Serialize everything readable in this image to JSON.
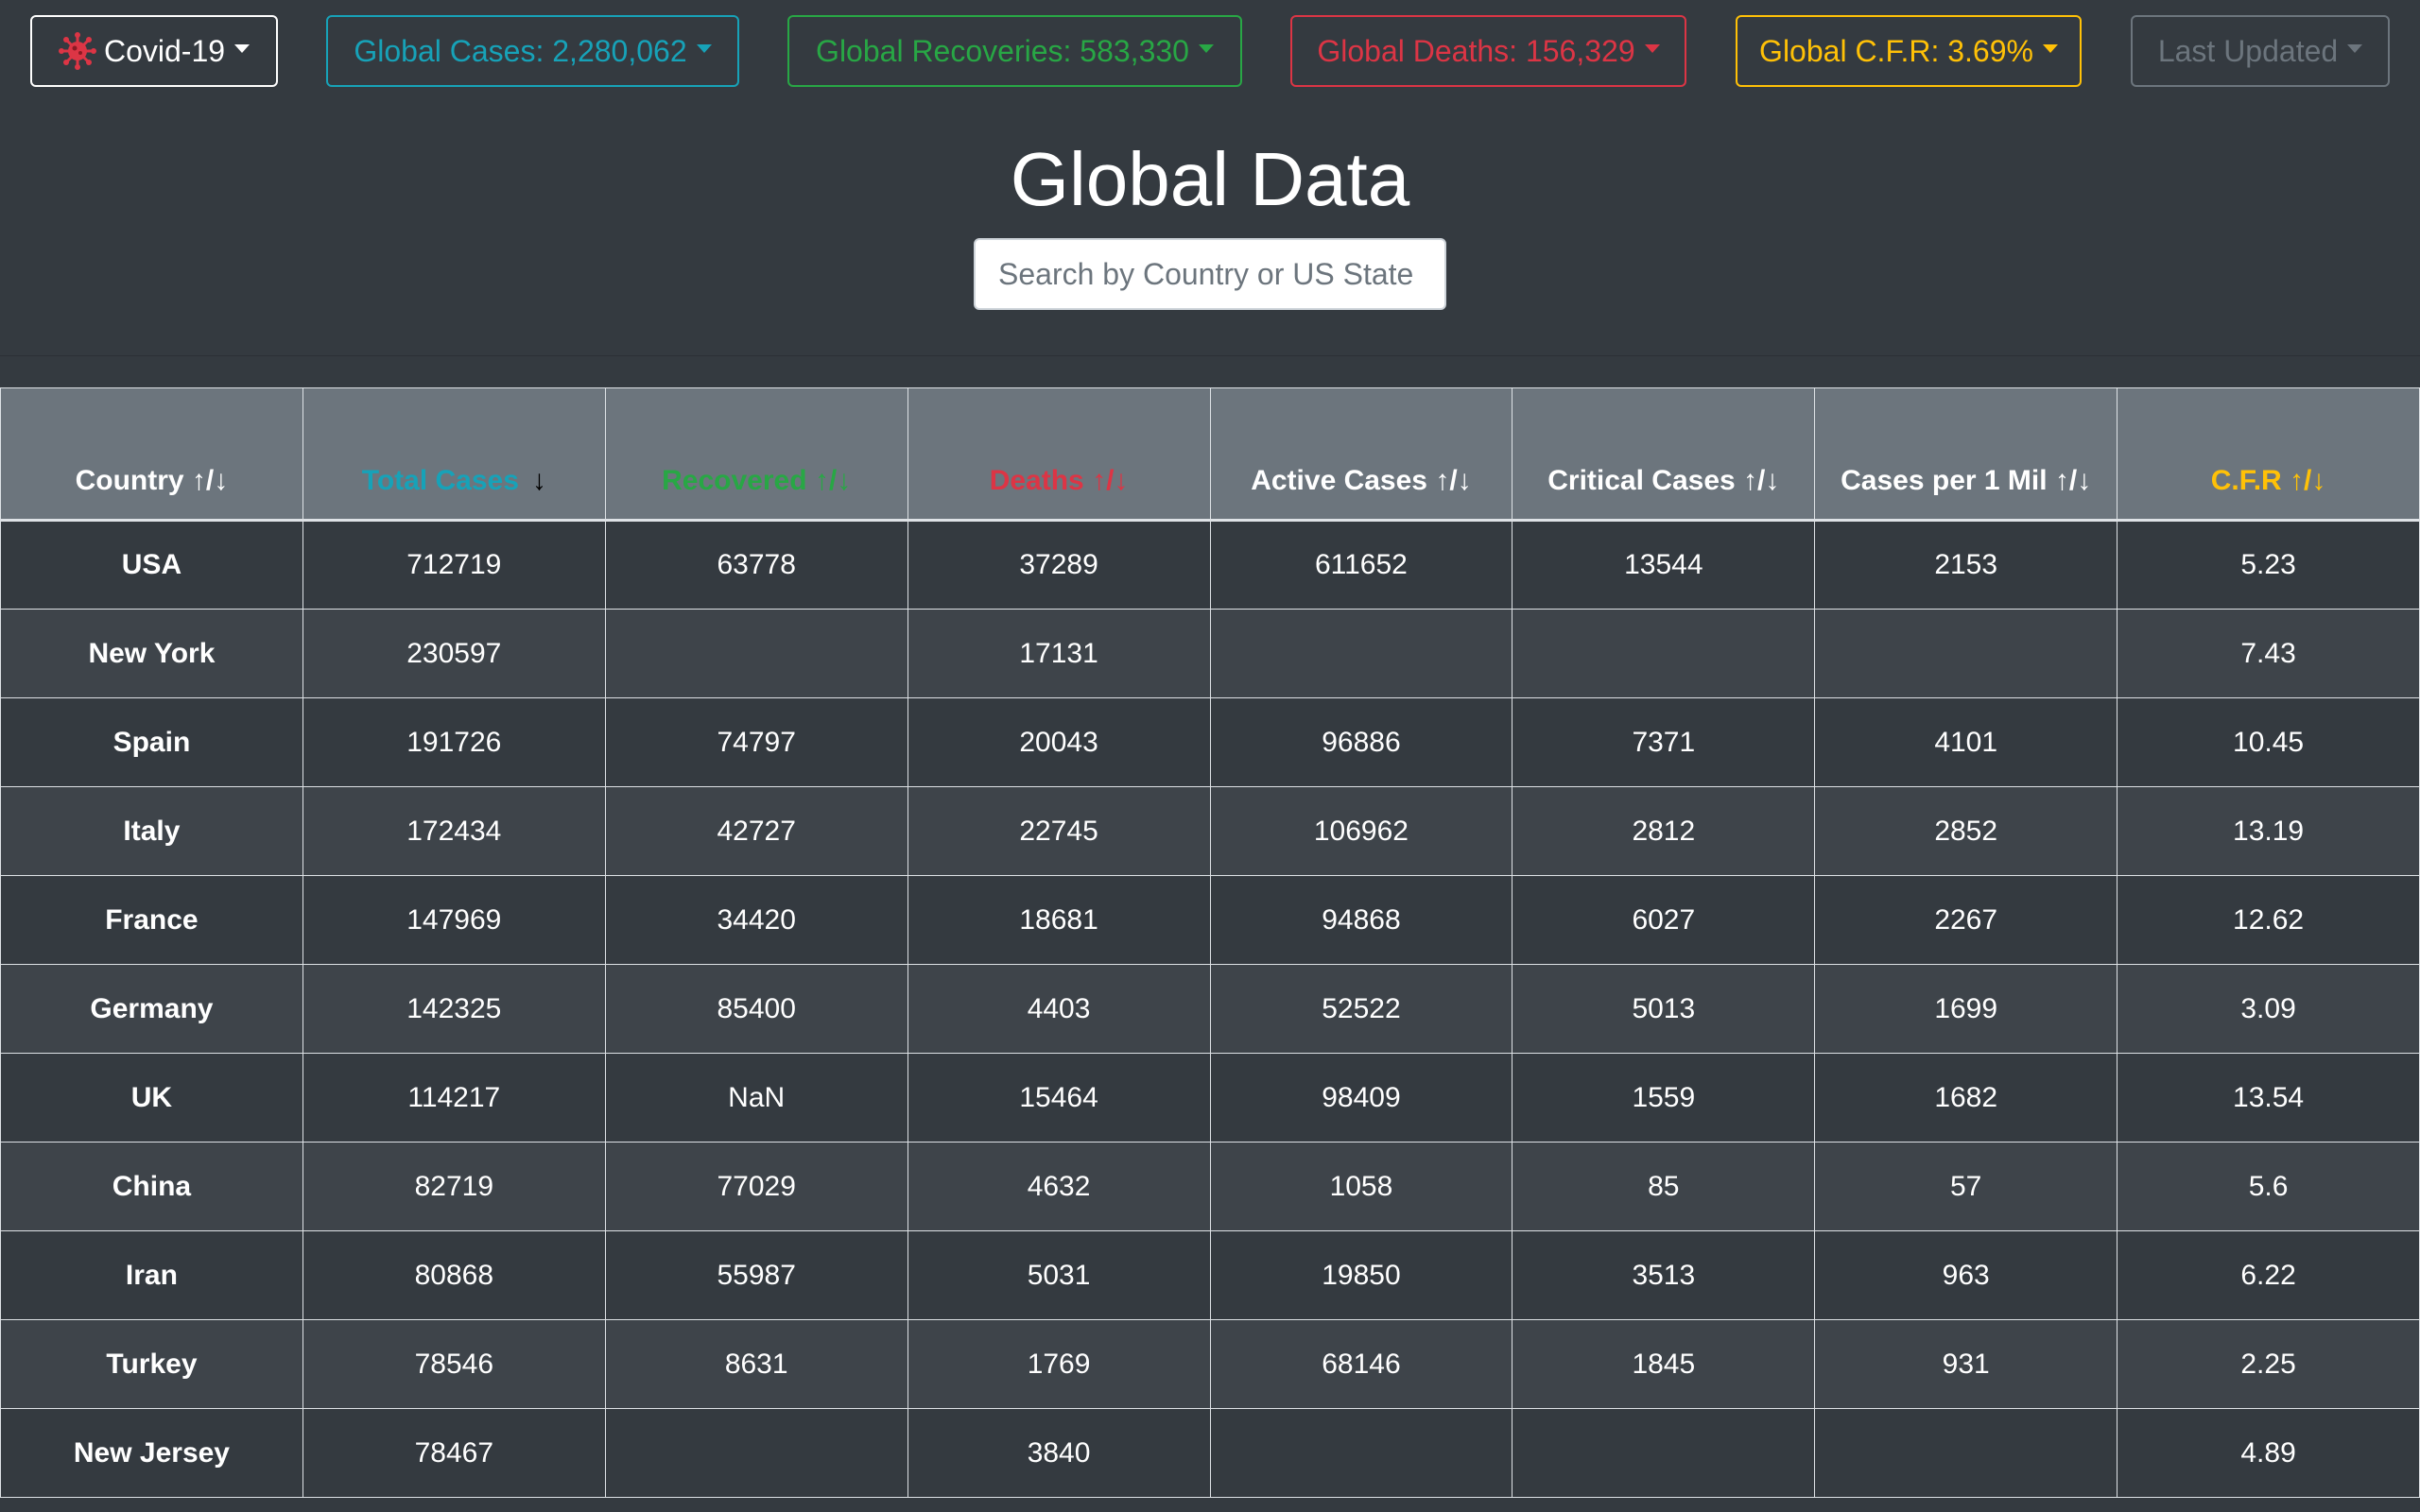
{
  "nav": {
    "brand": "Covid-19",
    "cases": "Global Cases: 2,280,062",
    "recoveries": "Global Recoveries: 583,330",
    "deaths": "Global Deaths: 156,329",
    "cfr": "Global C.F.R: 3.69%",
    "updated": "Last Updated"
  },
  "title": "Global Data",
  "search": {
    "placeholder": "Search by Country or US State"
  },
  "colors": {
    "cases": "#17a2b8",
    "recovered": "#28a745",
    "deaths": "#dc3545",
    "cfr": "#ffc107",
    "updated": "#6c757d",
    "background": "#343a40"
  },
  "table": {
    "headers": {
      "country": "Country ↑/↓",
      "cases": "Total Cases",
      "cases_sort": "↓",
      "recovered": "Recovered ↑/↓",
      "deaths": "Deaths ↑/↓",
      "active": "Active Cases ↑/↓",
      "critical": "Critical Cases ↑/↓",
      "permil": "Cases per 1 Mil ↑/↓",
      "cfr": "C.F.R ↑/↓"
    },
    "rows": [
      {
        "country": "USA",
        "cases": "712719",
        "recovered": "63778",
        "deaths": "37289",
        "active": "611652",
        "critical": "13544",
        "permil": "2153",
        "cfr": "5.23"
      },
      {
        "country": "New York",
        "cases": "230597",
        "recovered": "",
        "deaths": "17131",
        "active": "",
        "critical": "",
        "permil": "",
        "cfr": "7.43"
      },
      {
        "country": "Spain",
        "cases": "191726",
        "recovered": "74797",
        "deaths": "20043",
        "active": "96886",
        "critical": "7371",
        "permil": "4101",
        "cfr": "10.45"
      },
      {
        "country": "Italy",
        "cases": "172434",
        "recovered": "42727",
        "deaths": "22745",
        "active": "106962",
        "critical": "2812",
        "permil": "2852",
        "cfr": "13.19"
      },
      {
        "country": "France",
        "cases": "147969",
        "recovered": "34420",
        "deaths": "18681",
        "active": "94868",
        "critical": "6027",
        "permil": "2267",
        "cfr": "12.62"
      },
      {
        "country": "Germany",
        "cases": "142325",
        "recovered": "85400",
        "deaths": "4403",
        "active": "52522",
        "critical": "5013",
        "permil": "1699",
        "cfr": "3.09"
      },
      {
        "country": "UK",
        "cases": "114217",
        "recovered": "NaN",
        "deaths": "15464",
        "active": "98409",
        "critical": "1559",
        "permil": "1682",
        "cfr": "13.54"
      },
      {
        "country": "China",
        "cases": "82719",
        "recovered": "77029",
        "deaths": "4632",
        "active": "1058",
        "critical": "85",
        "permil": "57",
        "cfr": "5.6"
      },
      {
        "country": "Iran",
        "cases": "80868",
        "recovered": "55987",
        "deaths": "5031",
        "active": "19850",
        "critical": "3513",
        "permil": "963",
        "cfr": "6.22"
      },
      {
        "country": "Turkey",
        "cases": "78546",
        "recovered": "8631",
        "deaths": "1769",
        "active": "68146",
        "critical": "1845",
        "permil": "931",
        "cfr": "2.25"
      },
      {
        "country": "New Jersey",
        "cases": "78467",
        "recovered": "",
        "deaths": "3840",
        "active": "",
        "critical": "",
        "permil": "",
        "cfr": "4.89"
      }
    ]
  }
}
